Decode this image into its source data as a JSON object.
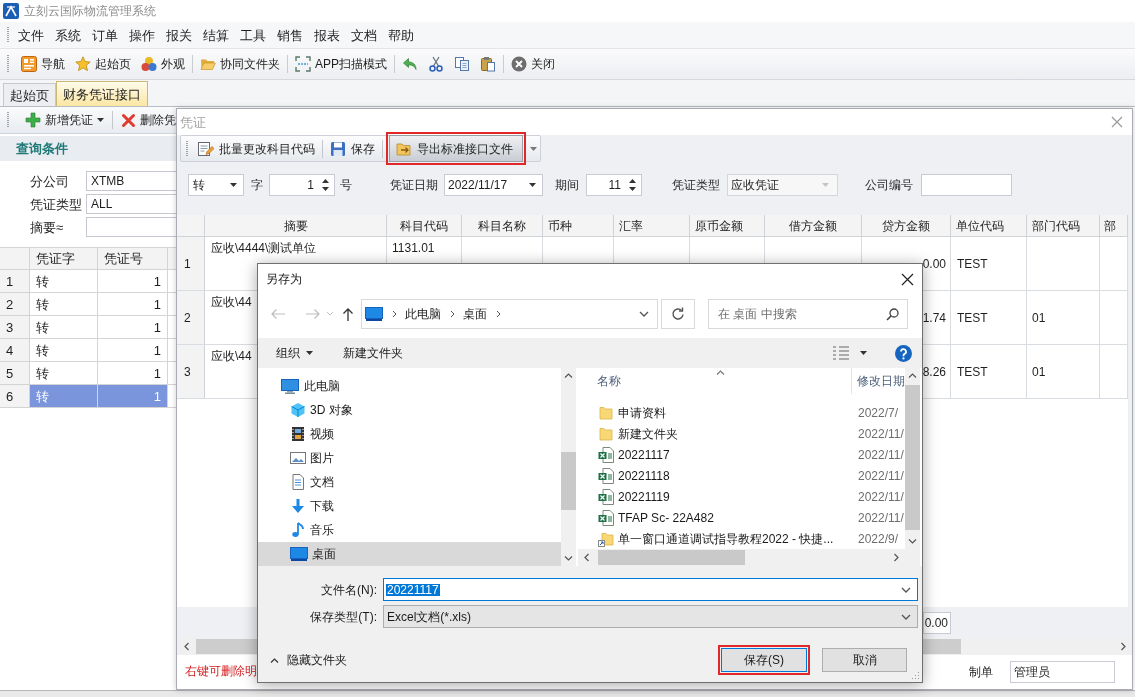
{
  "main_window": {
    "title": "立刻云国际物流管理系统",
    "menu": [
      "文件",
      "系统",
      "订单",
      "操作",
      "报关",
      "结算",
      "工具",
      "销售",
      "报表",
      "文档",
      "帮助"
    ],
    "toolbar_groups": [
      {
        "items": [
          {
            "kind": "button",
            "label": "导航"
          },
          {
            "kind": "button",
            "label": "起始页"
          },
          {
            "kind": "button",
            "label": "外观"
          }
        ]
      },
      {
        "items": [
          {
            "kind": "button",
            "label": "协同文件夹"
          }
        ]
      },
      {
        "items": [
          {
            "kind": "button",
            "label": "APP扫描模式"
          }
        ]
      },
      {
        "items": [
          {
            "kind": "icon_button"
          },
          {
            "kind": "icon_button"
          },
          {
            "kind": "icon_button"
          },
          {
            "kind": "icon_button"
          }
        ]
      },
      {
        "items": [
          {
            "kind": "button",
            "label": "关闭"
          }
        ]
      }
    ],
    "tabs": [
      {
        "label": "起始页",
        "selected": false
      },
      {
        "label": "财务凭证接口",
        "selected": true
      }
    ]
  },
  "query_panel": {
    "toolbar": [
      {
        "label": "新增凭证",
        "dropdown": true
      },
      {
        "label": "删除凭",
        "dropdown": false
      }
    ],
    "heading": "查询条件",
    "fields": [
      {
        "label": "分公司",
        "value": "XTMB"
      },
      {
        "label": "凭证类型",
        "value": "ALL"
      },
      {
        "label": "摘要≈"
      }
    ],
    "table": {
      "columns": [
        "凭证字",
        "凭证号"
      ],
      "rows": [
        {
          "number": "1",
          "cells": [
            "转",
            "1"
          ],
          "selected": false
        },
        {
          "number": "2",
          "cells": [
            "转",
            "1"
          ],
          "selected": false
        },
        {
          "number": "3",
          "cells": [
            "转",
            "1"
          ],
          "selected": false
        },
        {
          "number": "4",
          "cells": [
            "转",
            "1"
          ],
          "selected": false
        },
        {
          "number": "5",
          "cells": [
            "转",
            "1"
          ],
          "selected": false
        },
        {
          "number": "6",
          "cells": [
            "转",
            "1"
          ],
          "selected": true
        }
      ]
    }
  },
  "voucher_dialog": {
    "title": "凭证",
    "toolbar": [
      {
        "label": "批量更改科目代码",
        "highlighted": false
      },
      {
        "label": "保存",
        "highlighted": false
      },
      {
        "label": "导出标准接口文件",
        "highlighted": true
      }
    ],
    "form": {
      "word": "转",
      "word_label": "字",
      "number": "1",
      "number_label": "号",
      "date_label": "凭证日期",
      "date": "2022/11/17",
      "period_label": "期间",
      "period": "11",
      "type_label": "凭证类型",
      "type": "应收凭证",
      "type_disabled": true,
      "company_label": "公司编号"
    },
    "table": {
      "columns": [
        "摘要",
        "科目代码",
        "科目名称",
        "币种",
        "汇率",
        "原币金额",
        "借方金额",
        "贷方金额",
        "单位代码",
        "部门代码",
        "部"
      ],
      "rows": [
        {
          "number": "1",
          "summary": "应收\\4444\\测试单位",
          "account_code": "1131.01",
          "credit": "0.00",
          "unit_code": "TEST"
        },
        {
          "number": "2",
          "summary": "应收\\44",
          "credit": "1.74",
          "unit_code": "TEST",
          "department_code": "01"
        },
        {
          "number": "3",
          "summary": "应收\\44",
          "credit": "8.26",
          "unit_code": "TEST",
          "department_code": "01"
        }
      ]
    },
    "total": "0.00",
    "note": "右键可删除明",
    "creator_label": "制单",
    "creator": "管理员"
  },
  "save_dialog": {
    "title": "另存为",
    "path": [
      "此电脑",
      "桌面"
    ],
    "search": {
      "placeholder": "在 桌面 中搜索"
    },
    "organize": "组织",
    "new_folder": "新建文件夹",
    "tree": [
      {
        "label": "此电脑",
        "selected": false,
        "children": [
          {
            "label": "3D 对象",
            "selected": false
          },
          {
            "label": "视频",
            "selected": false
          },
          {
            "label": "图片",
            "selected": false
          },
          {
            "label": "文档",
            "selected": false
          },
          {
            "label": "下载",
            "selected": false
          },
          {
            "label": "音乐",
            "selected": false
          },
          {
            "label": "桌面",
            "selected": true
          }
        ]
      }
    ],
    "columns": [
      "名称",
      "修改日期"
    ],
    "files": [
      {
        "kind": "folder",
        "name": "申请资料",
        "modified": "2022/7/"
      },
      {
        "kind": "folder",
        "name": "新建文件夹",
        "modified": "2022/11/"
      },
      {
        "kind": "excel",
        "name": "20221117",
        "modified": "2022/11/"
      },
      {
        "kind": "excel",
        "name": "20221118",
        "modified": "2022/11/"
      },
      {
        "kind": "excel",
        "name": "20221119",
        "modified": "2022/11/"
      },
      {
        "kind": "excel",
        "name": "TFAP Sc- 22A482",
        "modified": "2022/11/"
      },
      {
        "kind": "shortcut",
        "name": "单一窗口通道调试指导教程2022 - 快捷...",
        "modified": "2022/9/"
      }
    ],
    "file_name_label": "文件名(N):",
    "file_name": "20221117",
    "file_name_selected": true,
    "file_type_label": "保存类型(T):",
    "file_type": "Excel文档(*.xls)",
    "hide_folders": "隐藏文件夹",
    "buttons": [
      {
        "label": "保存(S)",
        "highlighted": true
      },
      {
        "label": "取消",
        "highlighted": false
      }
    ]
  }
}
